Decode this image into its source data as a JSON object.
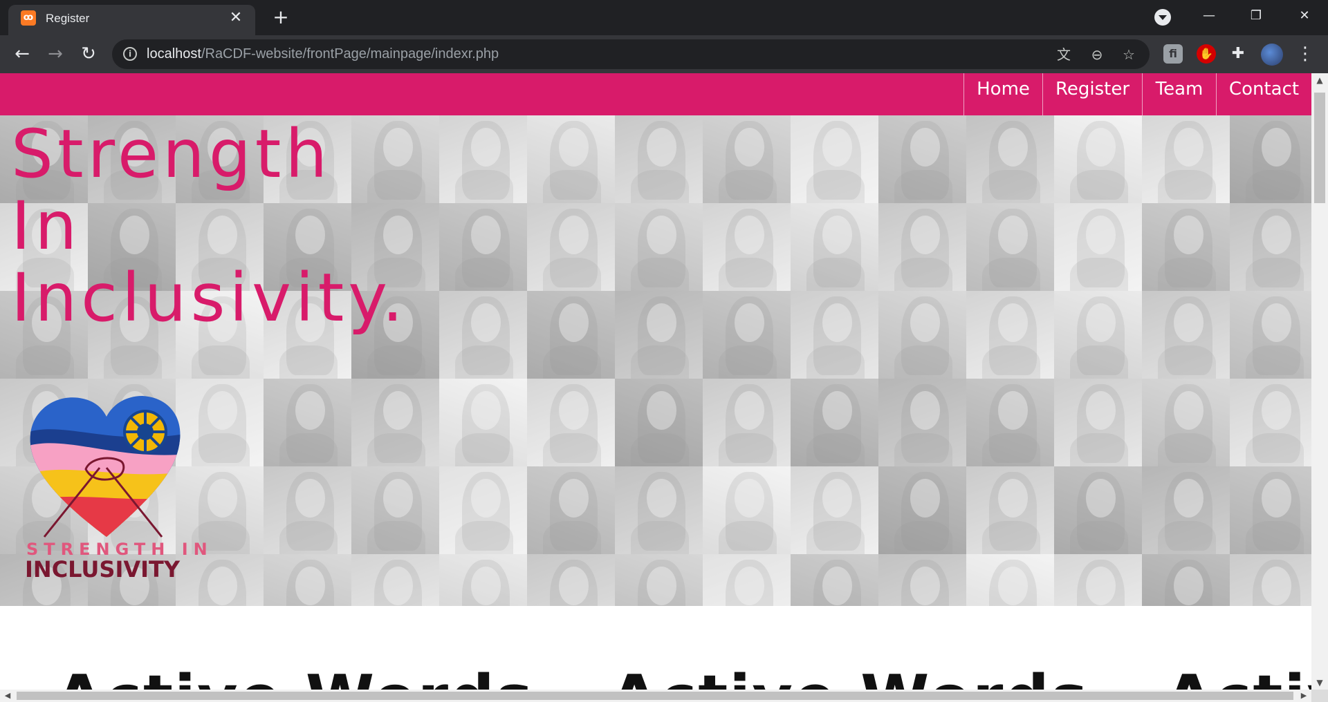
{
  "browser": {
    "tab_title": "Register",
    "tab_close": "✕",
    "new_tab": "+",
    "url_host": "localhost",
    "url_path": "/RaCDF-website/frontPage/mainpage/indexr.php",
    "window_controls": {
      "minimize": "—",
      "restore": "❐",
      "close": "✕"
    },
    "icons": [
      "back-icon",
      "forward-icon",
      "reload-icon",
      "site-info-icon",
      "translate-icon",
      "zoom-out-icon",
      "bookmark-star-icon",
      "extension-icon",
      "adblock-icon",
      "puzzle-icon",
      "profile-avatar",
      "menu-icon"
    ]
  },
  "site": {
    "nav": [
      "Home",
      "Register",
      "Team",
      "Contact"
    ],
    "headline": [
      "Strength",
      "In",
      "Inclusivity."
    ],
    "logo": {
      "line1": "STRENGTH IN",
      "line2": "INCLUSIVITY"
    },
    "marquee": [
      "Active Words",
      "Active Words",
      "Active Words"
    ],
    "colors": {
      "brand": "#d81b6a",
      "logo_blue": "#2a63c9",
      "logo_pink": "#f7a1c4",
      "logo_yellow": "#f6c21a",
      "logo_red": "#e63946",
      "logo_gold": "#f2b705"
    }
  }
}
